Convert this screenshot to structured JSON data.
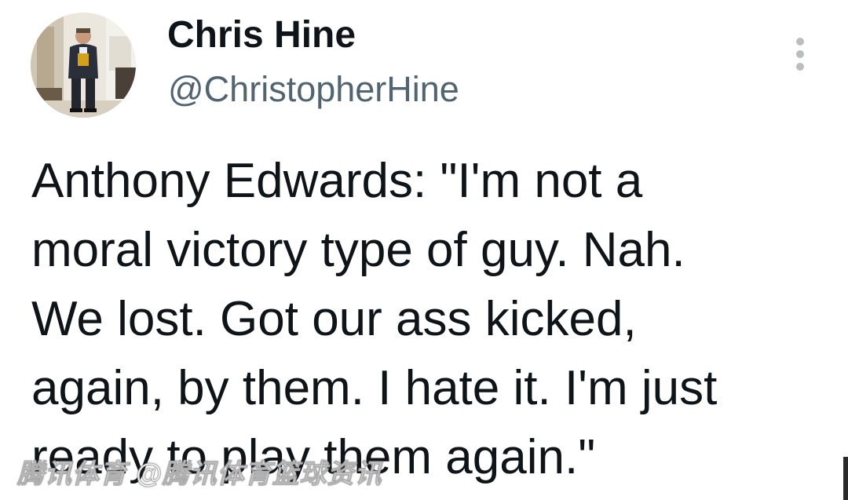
{
  "author": {
    "display_name": "Chris Hine",
    "handle": "@ChristopherHine"
  },
  "tweet": {
    "lines": [
      "Anthony Edwards: \"I'm not a",
      "moral victory type of guy. Nah.",
      "We lost. Got our ass kicked,",
      "again, by them. I hate it. I'm just",
      "ready to play them again.\""
    ]
  },
  "menu": {
    "icon": "more-vertical-icon"
  },
  "watermark": {
    "text": "腾讯体育 @腾讯体育篮球资讯"
  },
  "colors": {
    "text_primary": "#0f1419",
    "text_secondary": "#536471",
    "menu_dots": "#b9bec4",
    "background": "#ffffff"
  }
}
